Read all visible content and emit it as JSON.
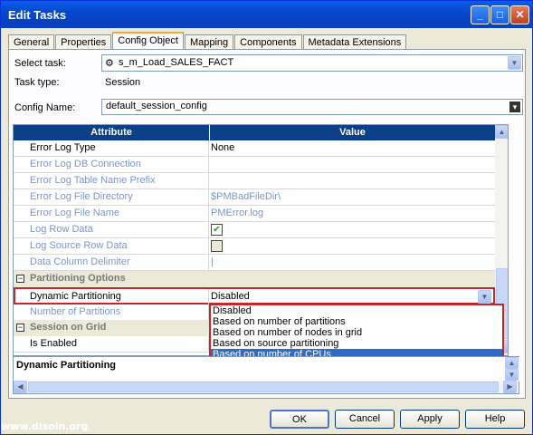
{
  "window": {
    "title": "Edit Tasks"
  },
  "tabs": [
    "General",
    "Properties",
    "Config Object",
    "Mapping",
    "Components",
    "Metadata Extensions"
  ],
  "form": {
    "select_task_label": "Select task:",
    "select_task_value": "s_m_Load_SALES_FACT",
    "task_type_label": "Task type:",
    "task_type_value": "Session",
    "config_name_label": "Config Name:",
    "config_name_value": "default_session_config"
  },
  "grid": {
    "headers": {
      "attribute": "Attribute",
      "value": "Value"
    },
    "rows": [
      {
        "attr": "Error Log Type",
        "value": "None",
        "enabled": true
      },
      {
        "attr": "Error Log DB Connection",
        "value": "",
        "enabled": false
      },
      {
        "attr": "Error Log Table Name Prefix",
        "value": "",
        "enabled": false
      },
      {
        "attr": "Error Log File Directory",
        "value": "$PMBadFileDir\\",
        "enabled": false
      },
      {
        "attr": "Error Log File Name",
        "value": "PMError.log",
        "enabled": false
      },
      {
        "attr": "Log Row Data",
        "checked": true,
        "enabled": false
      },
      {
        "attr": "Log Source Row Data",
        "checked": false,
        "enabled": false
      },
      {
        "attr": "Data Column Delimiter",
        "value": "|",
        "enabled": false
      }
    ],
    "section_partitioning": "Partitioning Options",
    "dynamic_partitioning_label": "Dynamic Partitioning",
    "dynamic_partitioning_value": "Disabled",
    "number_of_partitions_label": "Number of Partitions",
    "section_grid": "Session on Grid",
    "is_enabled_label": "Is Enabled"
  },
  "dropdown_options": [
    "Disabled",
    "Based on number of partitions",
    "Based on number of nodes in grid",
    "Based on source partitioning",
    "Based on number of CPUs"
  ],
  "description_title": "Dynamic Partitioning",
  "buttons": {
    "ok": "OK",
    "cancel": "Cancel",
    "apply": "Apply",
    "help": "Help"
  },
  "watermark": "www.disoln.org"
}
